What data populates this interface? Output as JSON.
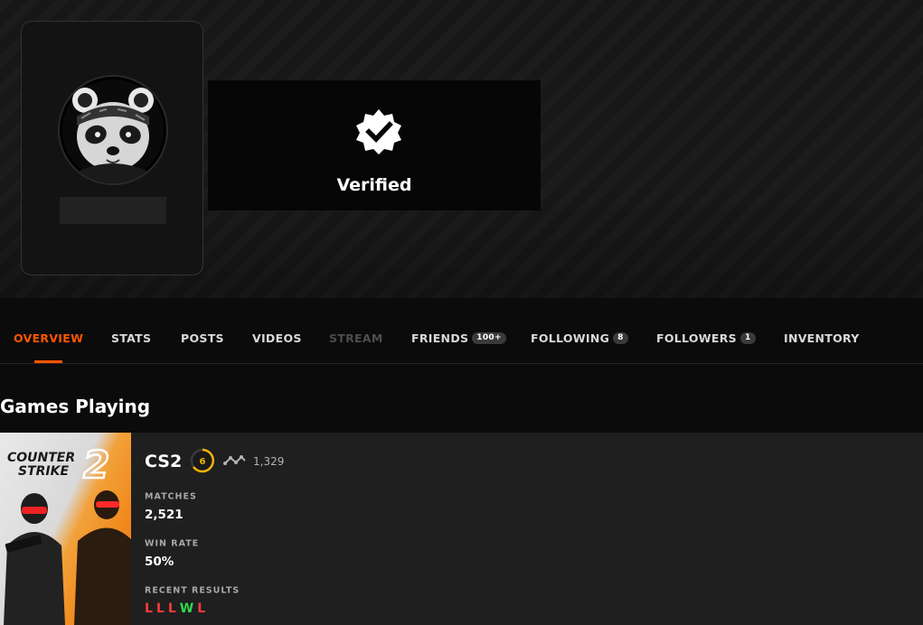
{
  "profile": {
    "verified_label": "Verified"
  },
  "nav": {
    "tabs": [
      {
        "label": "OVERVIEW",
        "active": true
      },
      {
        "label": "STATS"
      },
      {
        "label": "POSTS"
      },
      {
        "label": "VIDEOS"
      },
      {
        "label": "STREAM",
        "disabled": true
      },
      {
        "label": "FRIENDS",
        "badge": "100+"
      },
      {
        "label": "FOLLOWING",
        "badge": "8"
      },
      {
        "label": "FOLLOWERS",
        "badge": "1"
      },
      {
        "label": "INVENTORY"
      }
    ]
  },
  "games_section": {
    "title": "Games Playing"
  },
  "game": {
    "cover_title_line1": "COUNTER",
    "cover_title_line2": "STRIKE",
    "cover_number": "2",
    "name": "CS2",
    "level": "6",
    "elo": "1,329",
    "matches_label": "MATCHES",
    "matches_value": "2,521",
    "win_rate_label": "WIN RATE",
    "win_rate_value": "50%",
    "recent_results_label": "RECENT RESULTS",
    "recent_results": [
      "L",
      "L",
      "L",
      "W",
      "L"
    ]
  },
  "colors": {
    "accent": "#ff5500",
    "loss": "#ff3b3b",
    "win": "#32d74b",
    "level_ring": "#f5b400"
  },
  "icons": {
    "verified": "verified-badge-icon",
    "elo": "elo-chart-icon",
    "level": "skill-level-icon"
  }
}
